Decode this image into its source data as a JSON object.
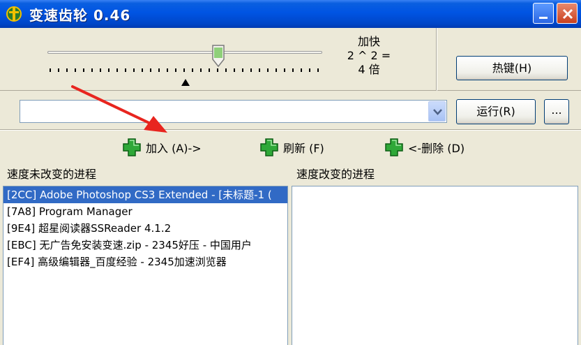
{
  "window": {
    "title": "变速齿轮 0.46",
    "icon": "gear-app-icon"
  },
  "speed": {
    "label_line1": "加快",
    "label_line2": "2 ^ 2 =",
    "label_line3": "4 倍",
    "multiplier": 4
  },
  "buttons": {
    "hotkey": "热键(H)",
    "run": "运行(R)",
    "browse": "..."
  },
  "program_combo": {
    "value": ""
  },
  "actions": {
    "add": "加入 (A)->",
    "refresh": "刷新 (F)",
    "delete": "<-删除 (D)"
  },
  "lists": {
    "unchanged_header": "速度未改变的进程",
    "changed_header": "速度改变的进程",
    "unchanged_items": [
      {
        "pid": "[2CC]",
        "name": "Adobe Photoshop CS3 Extended - [未标题-1 (",
        "selected": true
      },
      {
        "pid": "[7A8]",
        "name": "Program Manager",
        "selected": false
      },
      {
        "pid": "[9E4]",
        "name": "超星阅读器SSReader 4.1.2",
        "selected": false
      },
      {
        "pid": "[EBC]",
        "name": "无广告免安装变速.zip - 2345好压 - 中国用户",
        "selected": false
      },
      {
        "pid": "[EF4]",
        "name": "高级编辑器_百度经验 - 2345加速浏览器",
        "selected": false
      }
    ],
    "changed_items": []
  },
  "colors": {
    "titlebar": "#0054e3",
    "selection": "#316ac5",
    "annotation_arrow": "#e8251f",
    "plus_icon": "#2fa838"
  }
}
